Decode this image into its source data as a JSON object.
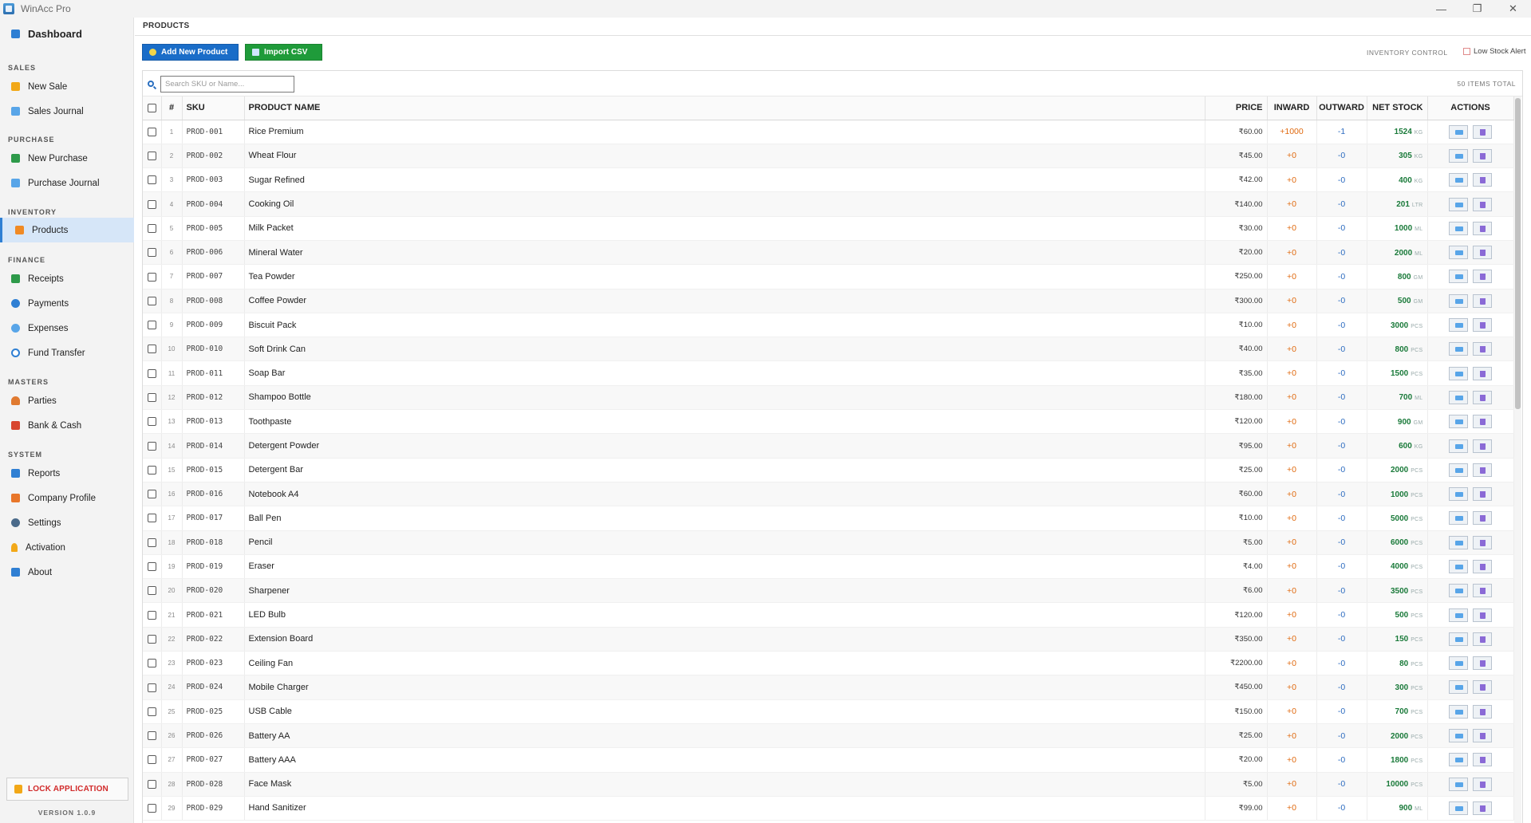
{
  "app": {
    "title": "WinAcc Pro",
    "minimize": "—",
    "maximize": "❐",
    "close": "✕"
  },
  "sidebar": {
    "dashboard": "Dashboard",
    "sections": {
      "sales": "SALES",
      "purchase": "PURCHASE",
      "inventory": "INVENTORY",
      "finance": "FINANCE",
      "masters": "MASTERS",
      "system": "SYSTEM"
    },
    "items": {
      "new_sale": "New Sale",
      "sales_journal": "Sales Journal",
      "new_purchase": "New Purchase",
      "purchase_journal": "Purchase Journal",
      "products": "Products",
      "receipts": "Receipts",
      "payments": "Payments",
      "expenses": "Expenses",
      "fund_transfer": "Fund Transfer",
      "parties": "Parties",
      "bank_cash": "Bank & Cash",
      "reports": "Reports",
      "company_profile": "Company Profile",
      "settings": "Settings",
      "activation": "Activation",
      "about": "About"
    },
    "lock_label": "LOCK APPLICATION",
    "version": "VERSION 1.0.9"
  },
  "header": {
    "title": "PRODUCTS"
  },
  "toolbar": {
    "add_label": "Add New Product",
    "import_label": "Import CSV",
    "inventory_control": "INVENTORY CONTROL",
    "low_stock_label": "Low Stock Alert"
  },
  "search": {
    "placeholder": "Search SKU or Name...",
    "value": "",
    "total": "50 ITEMS TOTAL"
  },
  "table": {
    "headers": {
      "index": "#",
      "sku": "SKU",
      "name": "PRODUCT NAME",
      "price": "PRICE",
      "inward": "INWARD",
      "outward": "OUTWARD",
      "net": "NET STOCK",
      "actions": "ACTIONS"
    },
    "rows": [
      {
        "i": "1",
        "sku": "PROD-001",
        "name": "Rice Premium",
        "price": "₹60.00",
        "in": "+1000",
        "out": "-1",
        "net": "1524",
        "unit": "KG"
      },
      {
        "i": "2",
        "sku": "PROD-002",
        "name": "Wheat Flour",
        "price": "₹45.00",
        "in": "+0",
        "out": "-0",
        "net": "305",
        "unit": "KG"
      },
      {
        "i": "3",
        "sku": "PROD-003",
        "name": "Sugar Refined",
        "price": "₹42.00",
        "in": "+0",
        "out": "-0",
        "net": "400",
        "unit": "KG"
      },
      {
        "i": "4",
        "sku": "PROD-004",
        "name": "Cooking Oil",
        "price": "₹140.00",
        "in": "+0",
        "out": "-0",
        "net": "201",
        "unit": "LTR"
      },
      {
        "i": "5",
        "sku": "PROD-005",
        "name": "Milk Packet",
        "price": "₹30.00",
        "in": "+0",
        "out": "-0",
        "net": "1000",
        "unit": "ML"
      },
      {
        "i": "6",
        "sku": "PROD-006",
        "name": "Mineral Water",
        "price": "₹20.00",
        "in": "+0",
        "out": "-0",
        "net": "2000",
        "unit": "ML"
      },
      {
        "i": "7",
        "sku": "PROD-007",
        "name": "Tea Powder",
        "price": "₹250.00",
        "in": "+0",
        "out": "-0",
        "net": "800",
        "unit": "GM"
      },
      {
        "i": "8",
        "sku": "PROD-008",
        "name": "Coffee Powder",
        "price": "₹300.00",
        "in": "+0",
        "out": "-0",
        "net": "500",
        "unit": "GM"
      },
      {
        "i": "9",
        "sku": "PROD-009",
        "name": "Biscuit Pack",
        "price": "₹10.00",
        "in": "+0",
        "out": "-0",
        "net": "3000",
        "unit": "PCS"
      },
      {
        "i": "10",
        "sku": "PROD-010",
        "name": "Soft Drink Can",
        "price": "₹40.00",
        "in": "+0",
        "out": "-0",
        "net": "800",
        "unit": "PCS"
      },
      {
        "i": "11",
        "sku": "PROD-011",
        "name": "Soap Bar",
        "price": "₹35.00",
        "in": "+0",
        "out": "-0",
        "net": "1500",
        "unit": "PCS"
      },
      {
        "i": "12",
        "sku": "PROD-012",
        "name": "Shampoo Bottle",
        "price": "₹180.00",
        "in": "+0",
        "out": "-0",
        "net": "700",
        "unit": "ML"
      },
      {
        "i": "13",
        "sku": "PROD-013",
        "name": "Toothpaste",
        "price": "₹120.00",
        "in": "+0",
        "out": "-0",
        "net": "900",
        "unit": "GM"
      },
      {
        "i": "14",
        "sku": "PROD-014",
        "name": "Detergent Powder",
        "price": "₹95.00",
        "in": "+0",
        "out": "-0",
        "net": "600",
        "unit": "KG"
      },
      {
        "i": "15",
        "sku": "PROD-015",
        "name": "Detergent Bar",
        "price": "₹25.00",
        "in": "+0",
        "out": "-0",
        "net": "2000",
        "unit": "PCS"
      },
      {
        "i": "16",
        "sku": "PROD-016",
        "name": "Notebook A4",
        "price": "₹60.00",
        "in": "+0",
        "out": "-0",
        "net": "1000",
        "unit": "PCS"
      },
      {
        "i": "17",
        "sku": "PROD-017",
        "name": "Ball Pen",
        "price": "₹10.00",
        "in": "+0",
        "out": "-0",
        "net": "5000",
        "unit": "PCS"
      },
      {
        "i": "18",
        "sku": "PROD-018",
        "name": "Pencil",
        "price": "₹5.00",
        "in": "+0",
        "out": "-0",
        "net": "6000",
        "unit": "PCS"
      },
      {
        "i": "19",
        "sku": "PROD-019",
        "name": "Eraser",
        "price": "₹4.00",
        "in": "+0",
        "out": "-0",
        "net": "4000",
        "unit": "PCS"
      },
      {
        "i": "20",
        "sku": "PROD-020",
        "name": "Sharpener",
        "price": "₹6.00",
        "in": "+0",
        "out": "-0",
        "net": "3500",
        "unit": "PCS"
      },
      {
        "i": "21",
        "sku": "PROD-021",
        "name": "LED Bulb",
        "price": "₹120.00",
        "in": "+0",
        "out": "-0",
        "net": "500",
        "unit": "PCS"
      },
      {
        "i": "22",
        "sku": "PROD-022",
        "name": "Extension Board",
        "price": "₹350.00",
        "in": "+0",
        "out": "-0",
        "net": "150",
        "unit": "PCS"
      },
      {
        "i": "23",
        "sku": "PROD-023",
        "name": "Ceiling Fan",
        "price": "₹2200.00",
        "in": "+0",
        "out": "-0",
        "net": "80",
        "unit": "PCS"
      },
      {
        "i": "24",
        "sku": "PROD-024",
        "name": "Mobile Charger",
        "price": "₹450.00",
        "in": "+0",
        "out": "-0",
        "net": "300",
        "unit": "PCS"
      },
      {
        "i": "25",
        "sku": "PROD-025",
        "name": "USB Cable",
        "price": "₹150.00",
        "in": "+0",
        "out": "-0",
        "net": "700",
        "unit": "PCS"
      },
      {
        "i": "26",
        "sku": "PROD-026",
        "name": "Battery AA",
        "price": "₹25.00",
        "in": "+0",
        "out": "-0",
        "net": "2000",
        "unit": "PCS"
      },
      {
        "i": "27",
        "sku": "PROD-027",
        "name": "Battery AAA",
        "price": "₹20.00",
        "in": "+0",
        "out": "-0",
        "net": "1800",
        "unit": "PCS"
      },
      {
        "i": "28",
        "sku": "PROD-028",
        "name": "Face Mask",
        "price": "₹5.00",
        "in": "+0",
        "out": "-0",
        "net": "10000",
        "unit": "PCS"
      },
      {
        "i": "29",
        "sku": "PROD-029",
        "name": "Hand Sanitizer",
        "price": "₹99.00",
        "in": "+0",
        "out": "-0",
        "net": "900",
        "unit": "ML"
      }
    ]
  },
  "colors": {
    "accent": "#2f7fd3",
    "add_button": "#1a6dc8",
    "import_button": "#1f9b3a",
    "inward": "#e06a10",
    "outward": "#2d6cc0",
    "net_stock": "#1a7a3a",
    "lock": "#d12a2a"
  },
  "icons": {
    "dashboard": "bar-chart-icon",
    "new_sale": "bar-chart-icon",
    "sales_journal": "document-icon",
    "new_purchase": "truck-icon",
    "purchase_journal": "document-icon",
    "products": "box-icon",
    "receipts": "receipt-icon",
    "payments": "coin-icon",
    "expenses": "undo-icon",
    "fund_transfer": "refresh-icon",
    "parties": "person-icon",
    "bank_cash": "wallet-icon",
    "reports": "bar-chart-icon",
    "company_profile": "building-icon",
    "settings": "gear-icon",
    "activation": "key-icon",
    "about": "info-icon",
    "lock": "lock-icon",
    "search": "search-icon",
    "edit": "edit-icon",
    "delete": "delete-icon"
  }
}
